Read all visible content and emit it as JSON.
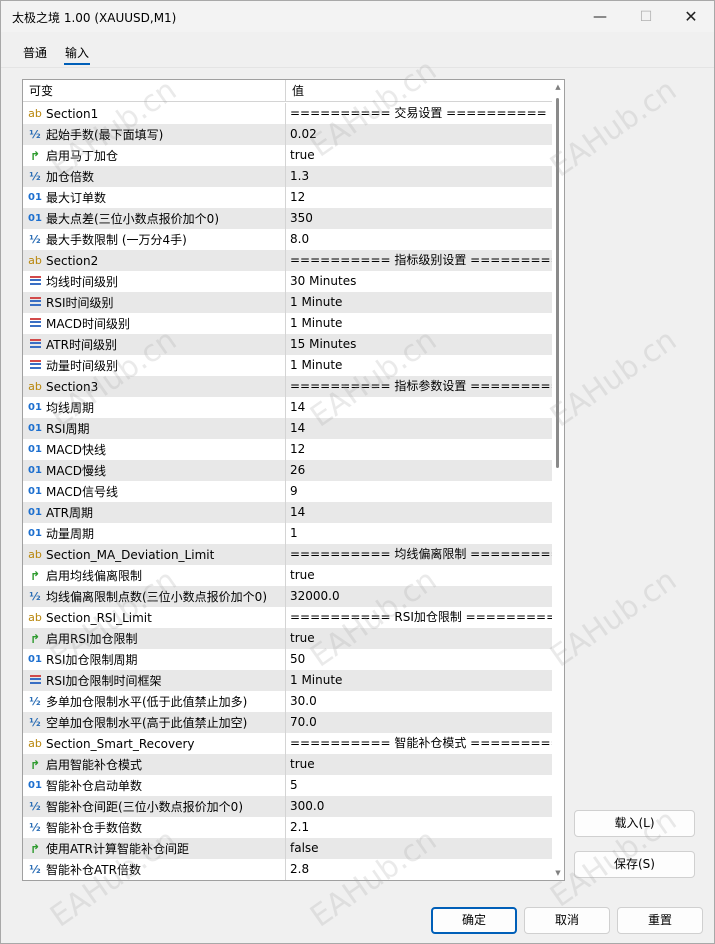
{
  "window": {
    "title": "太极之境 1.00 (XAUUSD,M1)",
    "min_glyph": "—",
    "max_glyph": "☐",
    "close_glyph": "✕"
  },
  "tabs": [
    {
      "label": "普通",
      "active": false
    },
    {
      "label": "输入",
      "active": true
    }
  ],
  "grid": {
    "col_name": "可变",
    "col_value": "值",
    "rows": [
      {
        "icon": "ab",
        "name": "Section1",
        "value": "========== 交易设置 =========="
      },
      {
        "icon": "half",
        "name": "起始手数(最下面填写)",
        "value": "0.02"
      },
      {
        "icon": "bool",
        "name": "启用马丁加仓",
        "value": "true"
      },
      {
        "icon": "half",
        "name": "加仓倍数",
        "value": "1.3"
      },
      {
        "icon": "num",
        "name": "最大订单数",
        "value": "12"
      },
      {
        "icon": "num",
        "name": "最大点差(三位小数点报价加个0)",
        "value": "350"
      },
      {
        "icon": "half",
        "name": "最大手数限制 (一万分4手)",
        "value": "8.0"
      },
      {
        "icon": "ab",
        "name": "Section2",
        "value": "========== 指标级别设置 =========="
      },
      {
        "icon": "enum",
        "name": "均线时间级别",
        "value": "30 Minutes"
      },
      {
        "icon": "enum",
        "name": "RSI时间级别",
        "value": "1 Minute"
      },
      {
        "icon": "enum",
        "name": "MACD时间级别",
        "value": "1 Minute"
      },
      {
        "icon": "enum",
        "name": "ATR时间级别",
        "value": "15 Minutes"
      },
      {
        "icon": "enum",
        "name": "动量时间级别",
        "value": "1 Minute"
      },
      {
        "icon": "ab",
        "name": "Section3",
        "value": "========== 指标参数设置 =========="
      },
      {
        "icon": "num",
        "name": "均线周期",
        "value": "14"
      },
      {
        "icon": "num",
        "name": "RSI周期",
        "value": "14"
      },
      {
        "icon": "num",
        "name": "MACD快线",
        "value": "12"
      },
      {
        "icon": "num",
        "name": "MACD慢线",
        "value": "26"
      },
      {
        "icon": "num",
        "name": "MACD信号线",
        "value": "9"
      },
      {
        "icon": "num",
        "name": "ATR周期",
        "value": "14"
      },
      {
        "icon": "num",
        "name": "动量周期",
        "value": "1"
      },
      {
        "icon": "ab",
        "name": "Section_MA_Deviation_Limit",
        "value": "========== 均线偏离限制 =========="
      },
      {
        "icon": "bool",
        "name": "启用均线偏离限制",
        "value": "true"
      },
      {
        "icon": "half",
        "name": "均线偏离限制点数(三位小数点报价加个0)",
        "value": "32000.0"
      },
      {
        "icon": "ab",
        "name": "Section_RSI_Limit",
        "value": "========== RSI加仓限制 =========="
      },
      {
        "icon": "bool",
        "name": "启用RSI加仓限制",
        "value": "true"
      },
      {
        "icon": "num",
        "name": "RSI加仓限制周期",
        "value": "50"
      },
      {
        "icon": "enum",
        "name": "RSI加仓限制时间框架",
        "value": "1 Minute"
      },
      {
        "icon": "half",
        "name": "多单加仓限制水平(低于此值禁止加多)",
        "value": "30.0"
      },
      {
        "icon": "half",
        "name": "空单加仓限制水平(高于此值禁止加空)",
        "value": "70.0"
      },
      {
        "icon": "ab",
        "name": "Section_Smart_Recovery",
        "value": "========== 智能补仓模式 =========="
      },
      {
        "icon": "bool",
        "name": "启用智能补仓模式",
        "value": "true"
      },
      {
        "icon": "num",
        "name": "智能补仓启动单数",
        "value": "5"
      },
      {
        "icon": "half",
        "name": "智能补仓间距(三位小数点报价加个0)",
        "value": "300.0"
      },
      {
        "icon": "half",
        "name": "智能补仓手数倍数",
        "value": "2.1"
      },
      {
        "icon": "bool",
        "name": "使用ATR计算智能补仓间距",
        "value": "false"
      },
      {
        "icon": "half",
        "name": "智能补仓ATR倍数",
        "value": "2.8"
      }
    ]
  },
  "icon_glyphs": {
    "ab": "ab",
    "half": "½",
    "num": "01",
    "bool": "↱"
  },
  "side_buttons": {
    "load": "载入(L)",
    "save": "保存(S)"
  },
  "bottom_buttons": {
    "ok": "确定",
    "cancel": "取消",
    "reset": "重置"
  },
  "watermark": "EAHub.cn"
}
